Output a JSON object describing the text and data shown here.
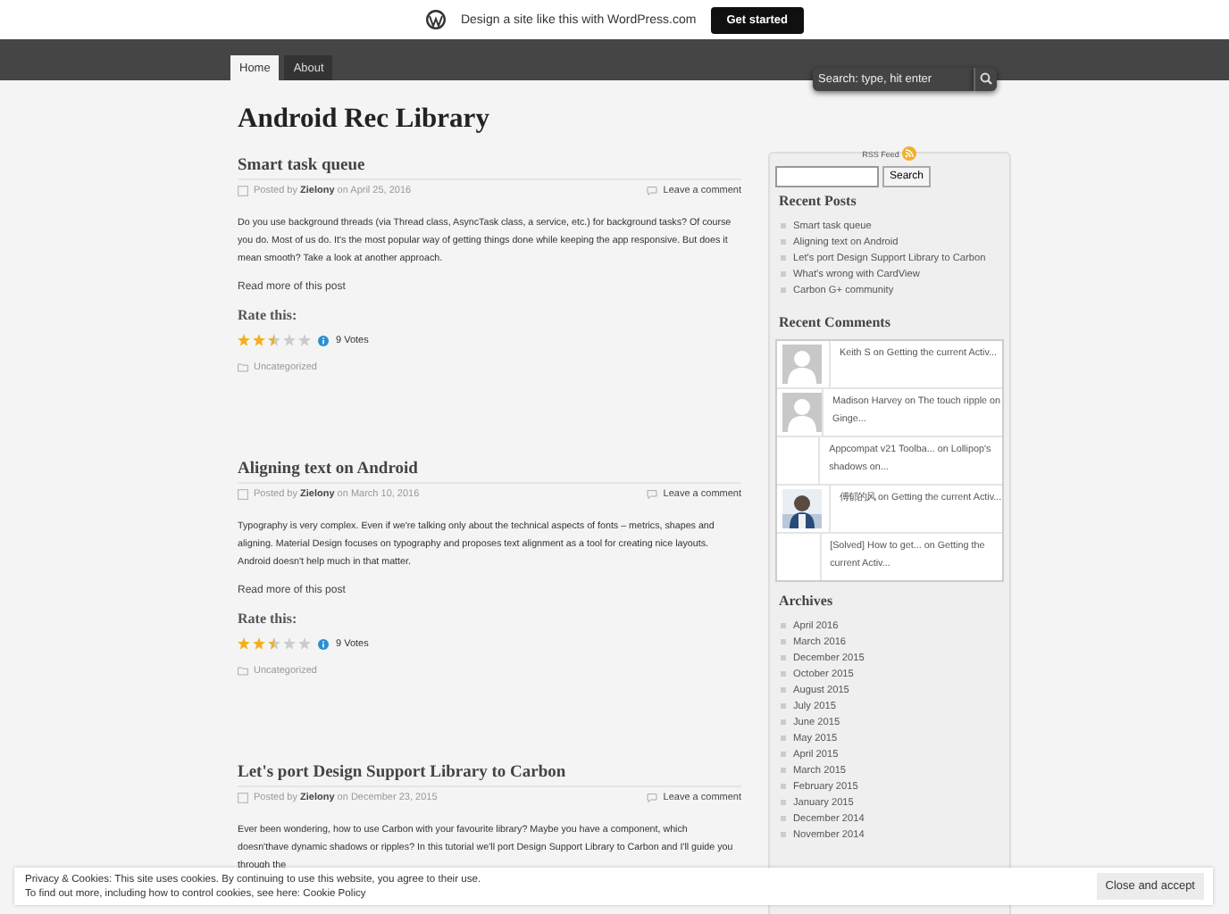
{
  "promo_bar": {
    "text": "Design a site like this with WordPress.com",
    "button": "Get started"
  },
  "nav": {
    "tabs": [
      {
        "label": "Home",
        "selected": true
      },
      {
        "label": "About",
        "selected": false
      }
    ],
    "search": {
      "placeholder": "Search: type, hit enter"
    }
  },
  "site_title": "Android Rec Library",
  "posts": [
    {
      "title": "Smart task queue",
      "posted_by": "Posted by",
      "author": "Zielony",
      "on": "on",
      "date": "April 25, 2016",
      "comment_link": "Leave a comment",
      "excerpt": "Do you use background threads (via Thread class, AsyncTask class, a service, etc.) for background tasks? Of course you do. Most of us do. It's the most popular way of getting things done while keeping the app responsive. But does it mean smooth? Take a look at another approach.",
      "read_more": "Read more of this post",
      "rate_heading": "Rate this:",
      "stars": 2.5,
      "votes": "9 Votes",
      "category": "Uncategorized"
    },
    {
      "title": "Aligning text on Android",
      "posted_by": "Posted by",
      "author": "Zielony",
      "on": "on",
      "date": "March 10, 2016",
      "comment_link": "Leave a comment",
      "excerpt": "Typography is very complex. Even if we're talking only about the technical aspects of fonts – metrics, shapes and aligning. Material Design focuses on typography and proposes text alignment as a tool for creating nice layouts. Android doesn't help much in that matter.",
      "read_more": "Read more of this post",
      "rate_heading": "Rate this:",
      "stars": 2.5,
      "votes": "9 Votes",
      "category": "Uncategorized"
    },
    {
      "title": "Let's port Design Support Library to Carbon",
      "posted_by": "Posted by",
      "author": "Zielony",
      "on": "on",
      "date": "December 23, 2015",
      "comment_link": "Leave a comment",
      "excerpt": "Ever been wondering, how to use Carbon with your favourite library? Maybe you have a component, which doesn'thave dynamic shadows or ripples? In this tutorial we'll port Design Support Library to Carbon and I'll guide you through the"
    }
  ],
  "sidebar": {
    "rss": "RSS Feed",
    "search_button": "Search",
    "recent_posts": {
      "heading": "Recent Posts",
      "items": [
        "Smart task queue",
        "Aligning text on Android",
        "Let's port Design Support Library to Carbon",
        "What's wrong with CardView",
        "Carbon G+ community"
      ]
    },
    "recent_comments": {
      "heading": "Recent Comments",
      "items": [
        {
          "kind": "default",
          "author": "Keith S",
          "on": "on",
          "post": "Getting the current Activ..."
        },
        {
          "kind": "default",
          "author": "Madison Harvey",
          "on": "on",
          "post": "The touch ripple on Ginge..."
        },
        {
          "kind": "text",
          "author": "Appcompat v21 Toolba...",
          "on": "on",
          "post": "Lollipop's shadows on..."
        },
        {
          "author": "傅郁的风",
          "on": "on",
          "post": "Getting the current Activ..."
        },
        {
          "kind": "text",
          "author": "[Solved] How to get...",
          "on": "on",
          "post": "Getting the current Activ..."
        }
      ]
    },
    "archives": {
      "heading": "Archives",
      "items": [
        "April 2016",
        "March 2016",
        "December 2015",
        "October 2015",
        "August 2015",
        "July 2015",
        "June 2015",
        "May 2015",
        "April 2015",
        "March 2015",
        "February 2015",
        "January 2015",
        "December 2014",
        "November 2014"
      ]
    }
  },
  "cookie_banner": {
    "line1": "Privacy & Cookies: This site uses cookies. By continuing to use this website, you agree to their use.",
    "line2": "To find out more, including how to control cookies, see here:",
    "link": "Cookie Policy",
    "button": "Close and accept"
  }
}
